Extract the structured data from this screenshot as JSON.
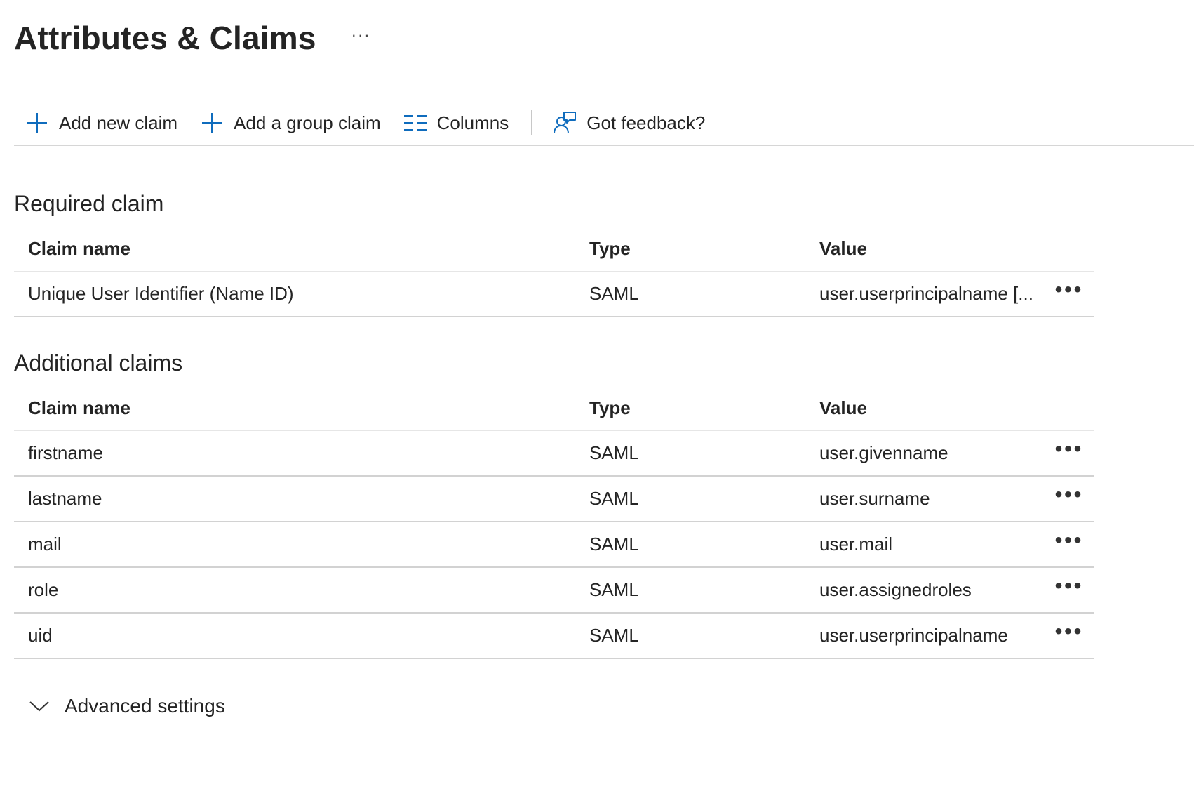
{
  "page": {
    "title": "Attributes & Claims",
    "more_label": "···"
  },
  "toolbar": {
    "add_claim_label": "Add new claim",
    "add_group_claim_label": "Add a group claim",
    "columns_label": "Columns",
    "feedback_label": "Got feedback?",
    "icons": {
      "add": "plus-icon",
      "columns": "columns-icon",
      "feedback": "feedback-icon"
    }
  },
  "required": {
    "title": "Required claim",
    "headers": {
      "name": "Claim name",
      "type": "Type",
      "value": "Value"
    },
    "rows": [
      {
        "name": "Unique User Identifier (Name ID)",
        "type": "SAML",
        "value": "user.userprincipalname [..."
      }
    ]
  },
  "additional": {
    "title": "Additional claims",
    "headers": {
      "name": "Claim name",
      "type": "Type",
      "value": "Value"
    },
    "rows": [
      {
        "name": "firstname",
        "type": "SAML",
        "value": "user.givenname"
      },
      {
        "name": "lastname",
        "type": "SAML",
        "value": "user.surname"
      },
      {
        "name": "mail",
        "type": "SAML",
        "value": "user.mail"
      },
      {
        "name": "role",
        "type": "SAML",
        "value": "user.assignedroles"
      },
      {
        "name": "uid",
        "type": "SAML",
        "value": "user.userprincipalname"
      }
    ]
  },
  "row_more_label": "•••",
  "advanced": {
    "label": "Advanced settings"
  },
  "colors": {
    "accent": "#0f6cbd",
    "text": "#242424",
    "divider": "#d2d2d2"
  }
}
